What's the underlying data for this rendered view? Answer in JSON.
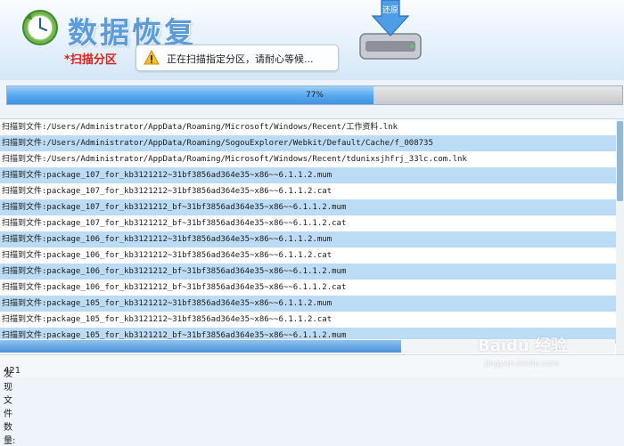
{
  "header": {
    "title": "数据恢复",
    "section_label": "扫描分区",
    "bubble_message": "正在扫描指定分区，请耐心等候...",
    "drive_label": "还原"
  },
  "progress": {
    "value": 0.77,
    "label": "77%"
  },
  "log_rows": [
    "扫描到文件:/Users/Administrator/AppData/Roaming/Microsoft/Windows/Recent/工作资料.lnk",
    "扫描到文件:/Users/Administrator/AppData/Roaming/SogouExplorer/Webkit/Default/Cache/f_008735",
    "扫描到文件:/Users/Administrator/AppData/Roaming/Microsoft/Windows/Recent/tdunixsjhfrj_33lc.com.lnk",
    "扫描到文件:package_107_for_kb3121212~31bf3856ad364e35~x86~~6.1.1.2.mum",
    "扫描到文件:package_107_for_kb3121212~31bf3856ad364e35~x86~~6.1.1.2.cat",
    "扫描到文件:package_107_for_kb3121212_bf~31bf3856ad364e35~x86~~6.1.1.2.mum",
    "扫描到文件:package_107_for_kb3121212_bf~31bf3856ad364e35~x86~~6.1.1.2.cat",
    "扫描到文件:package_106_for_kb3121212~31bf3856ad364e35~x86~~6.1.1.2.mum",
    "扫描到文件:package_106_for_kb3121212~31bf3856ad364e35~x86~~6.1.1.2.cat",
    "扫描到文件:package_106_for_kb3121212_bf~31bf3856ad364e35~x86~~6.1.1.2.mum",
    "扫描到文件:package_106_for_kb3121212_bf~31bf3856ad364e35~x86~~6.1.1.2.cat",
    "扫描到文件:package_105_for_kb3121212~31bf3856ad364e35~x86~~6.1.1.2.mum",
    "扫描到文件:package_105_for_kb3121212~31bf3856ad364e35~x86~~6.1.1.2.cat",
    "扫描到文件:package_105_for_kb3121212_bf~31bf3856ad364e35~x86~~6.1.1.2.mum"
  ],
  "status": {
    "found_label": "发现文件数量:",
    "found_count": "421"
  },
  "watermark": {
    "text": "Baidu 经验",
    "sub": "jingyan.baidu.com"
  },
  "colors": {
    "accent": "#5d9cd8",
    "section": "#e0201c",
    "row_alt": "#bcdcf5",
    "row_plain": "#ffffff"
  }
}
